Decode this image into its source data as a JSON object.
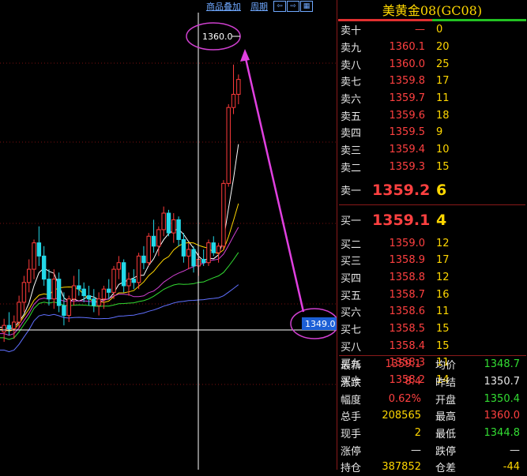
{
  "toolbar": {
    "overlay_label": "商品叠加",
    "period_label": "周期",
    "btn_left": "⇦",
    "btn_right": "⇨",
    "btn_grid": "▦"
  },
  "chart_annotations": {
    "top_price_label": "1360.0",
    "current_price_label": "1349.0"
  },
  "chart_data": {
    "type": "candlestick",
    "y_range": [
      1340,
      1362
    ],
    "candles": [
      [
        1343.8,
        1344.6,
        1343.2,
        1344.2
      ],
      [
        1344.2,
        1345.0,
        1343.6,
        1344.0
      ],
      [
        1344.0,
        1344.8,
        1343.4,
        1344.4
      ],
      [
        1344.4,
        1346.0,
        1344.0,
        1345.6
      ],
      [
        1345.6,
        1347.2,
        1345.0,
        1346.8
      ],
      [
        1346.8,
        1348.2,
        1346.2,
        1347.6
      ],
      [
        1347.6,
        1349.4,
        1347.0,
        1349.2
      ],
      [
        1349.2,
        1350.2,
        1347.8,
        1348.4
      ],
      [
        1348.4,
        1349.0,
        1346.6,
        1347.0
      ],
      [
        1347.0,
        1347.6,
        1345.4,
        1345.8
      ],
      [
        1345.8,
        1347.6,
        1345.2,
        1347.0
      ],
      [
        1347.0,
        1347.4,
        1345.0,
        1345.4
      ],
      [
        1345.4,
        1346.2,
        1344.2,
        1344.8
      ],
      [
        1344.8,
        1346.0,
        1344.4,
        1345.8
      ],
      [
        1345.8,
        1347.2,
        1345.4,
        1346.6
      ],
      [
        1346.6,
        1347.6,
        1346.0,
        1346.4
      ],
      [
        1346.4,
        1346.8,
        1345.6,
        1346.0
      ],
      [
        1346.0,
        1346.6,
        1345.4,
        1345.8
      ],
      [
        1345.8,
        1346.4,
        1345.0,
        1345.4
      ],
      [
        1345.4,
        1346.2,
        1344.8,
        1345.8
      ],
      [
        1345.8,
        1346.6,
        1345.2,
        1346.4
      ],
      [
        1346.4,
        1347.0,
        1345.8,
        1346.2
      ],
      [
        1346.2,
        1347.8,
        1345.8,
        1347.6
      ],
      [
        1347.6,
        1348.4,
        1347.0,
        1348.0
      ],
      [
        1348.0,
        1348.2,
        1346.2,
        1346.6
      ],
      [
        1346.6,
        1347.4,
        1346.0,
        1347.0
      ],
      [
        1347.0,
        1347.6,
        1346.4,
        1346.8
      ],
      [
        1346.8,
        1348.6,
        1346.4,
        1348.4
      ],
      [
        1348.4,
        1349.0,
        1347.6,
        1348.0
      ],
      [
        1348.0,
        1349.8,
        1347.8,
        1349.6
      ],
      [
        1349.6,
        1350.6,
        1348.6,
        1349.0
      ],
      [
        1349.0,
        1350.2,
        1348.4,
        1350.0
      ],
      [
        1350.0,
        1351.4,
        1349.6,
        1351.0
      ],
      [
        1351.0,
        1351.2,
        1349.6,
        1349.8
      ],
      [
        1349.8,
        1351.0,
        1349.2,
        1350.6
      ],
      [
        1350.6,
        1350.8,
        1349.0,
        1349.4
      ],
      [
        1349.4,
        1349.8,
        1348.0,
        1348.4
      ],
      [
        1348.4,
        1349.2,
        1347.6,
        1348.8
      ],
      [
        1348.8,
        1349.0,
        1347.4,
        1347.8
      ],
      [
        1347.8,
        1348.6,
        1347.2,
        1348.2
      ],
      [
        1348.2,
        1348.8,
        1347.8,
        1348.0
      ],
      [
        1348.0,
        1349.4,
        1347.8,
        1349.2
      ],
      [
        1349.2,
        1349.6,
        1348.4,
        1348.6
      ],
      [
        1348.6,
        1349.2,
        1348.0,
        1349.0
      ],
      [
        1349.0,
        1353.0,
        1348.8,
        1352.8
      ],
      [
        1352.8,
        1357.6,
        1352.6,
        1357.4
      ],
      [
        1357.4,
        1360.0,
        1357.0,
        1358.2
      ],
      [
        1358.2,
        1359.4,
        1357.6,
        1359.1
      ]
    ]
  },
  "panel": {
    "title": "美黄金08(GC08)",
    "ratio_red": 0.5,
    "asks": [
      {
        "label": "卖十",
        "price": "—",
        "qty": "0"
      },
      {
        "label": "卖九",
        "price": "1360.1",
        "qty": "20"
      },
      {
        "label": "卖八",
        "price": "1360.0",
        "qty": "25"
      },
      {
        "label": "卖七",
        "price": "1359.8",
        "qty": "17"
      },
      {
        "label": "卖六",
        "price": "1359.7",
        "qty": "11"
      },
      {
        "label": "卖五",
        "price": "1359.6",
        "qty": "18"
      },
      {
        "label": "卖四",
        "price": "1359.5",
        "qty": "9"
      },
      {
        "label": "卖三",
        "price": "1359.4",
        "qty": "10"
      },
      {
        "label": "卖二",
        "price": "1359.3",
        "qty": "15"
      }
    ],
    "ask1": {
      "label": "卖一",
      "price": "1359.2",
      "qty": "6"
    },
    "bid1": {
      "label": "买一",
      "price": "1359.1",
      "qty": "4"
    },
    "bids": [
      {
        "label": "买二",
        "price": "1359.0",
        "qty": "12"
      },
      {
        "label": "买三",
        "price": "1358.9",
        "qty": "17"
      },
      {
        "label": "买四",
        "price": "1358.8",
        "qty": "12"
      },
      {
        "label": "买五",
        "price": "1358.7",
        "qty": "16"
      },
      {
        "label": "买六",
        "price": "1358.6",
        "qty": "11"
      },
      {
        "label": "买七",
        "price": "1358.5",
        "qty": "15"
      },
      {
        "label": "买八",
        "price": "1358.4",
        "qty": "15"
      },
      {
        "label": "买九",
        "price": "1358.3",
        "qty": "11"
      },
      {
        "label": "买十",
        "price": "1358.2",
        "qty": "14"
      }
    ],
    "stats": [
      {
        "l1": "最新",
        "v1": "1359.1",
        "c1": "red",
        "l2": "均价",
        "v2": "1348.7",
        "c2": "green"
      },
      {
        "l1": "涨跌",
        "v1": "8.4",
        "c1": "red",
        "l2": "昨结",
        "v2": "1350.7",
        "c2": "white"
      },
      {
        "l1": "幅度",
        "v1": "0.62%",
        "c1": "red",
        "l2": "开盘",
        "v2": "1350.4",
        "c2": "green"
      },
      {
        "l1": "总手",
        "v1": "208565",
        "c1": "yellow",
        "l2": "最高",
        "v2": "1360.0",
        "c2": "red"
      },
      {
        "l1": "现手",
        "v1": "2",
        "c1": "yellow",
        "l2": "最低",
        "v2": "1344.8",
        "c2": "green"
      },
      {
        "l1": "涨停",
        "v1": "—",
        "c1": "white",
        "l2": "跌停",
        "v2": "—",
        "c2": "white"
      },
      {
        "l1": "持仓",
        "v1": "387852",
        "c1": "yellow",
        "l2": "仓差",
        "v2": "-44",
        "c2": "yellow"
      }
    ]
  }
}
